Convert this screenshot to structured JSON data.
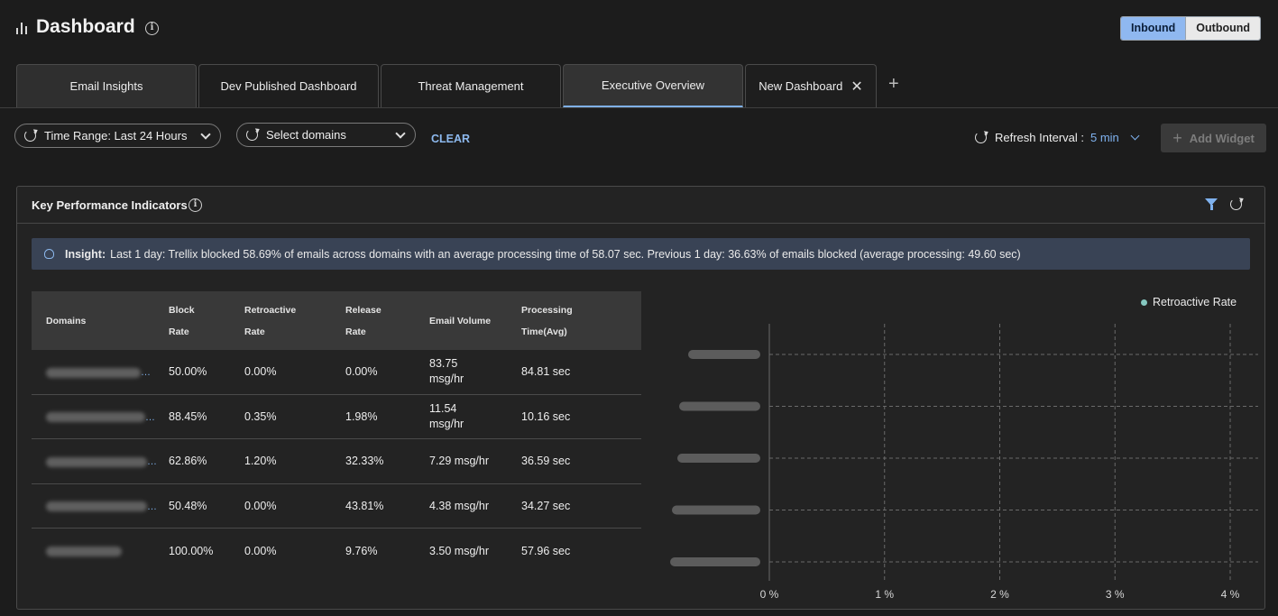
{
  "header": {
    "title": "Dashboard",
    "direction_toggle": {
      "options": [
        "Inbound",
        "Outbound"
      ],
      "selected": "Inbound"
    }
  },
  "tabs": [
    {
      "label": "Email Insights"
    },
    {
      "label": "Dev Published Dashboard"
    },
    {
      "label": "Threat Management"
    },
    {
      "label": "Executive Overview",
      "selected": true
    },
    {
      "label": "New Dashboard",
      "closable": true
    }
  ],
  "filters": {
    "time_range": "Time Range: Last 24 Hours",
    "domains_placeholder": "Select domains",
    "clear": "CLEAR",
    "refresh_label": "Refresh Interval :",
    "refresh_value": "5 min",
    "add_widget": "Add Widget"
  },
  "panel": {
    "title": "Key Performance Indicators",
    "insight_label": "Insight:",
    "insight_text": "Last 1 day: Trellix blocked 58.69% of emails across domains with an average processing time of 58.07 sec. Previous 1 day: 36.63% of emails blocked (average processing: 49.60 sec)"
  },
  "table": {
    "headers": {
      "domains": "Domains",
      "block_1": "Block",
      "block_2": "Rate",
      "retro_1": "Retroactive",
      "retro_2": "Rate",
      "release_1": "Release",
      "release_2": "Rate",
      "volume": "Email Volume",
      "proc_1": "Processing",
      "proc_2": "Time(Avg)"
    },
    "rows": [
      {
        "block": "50.00%",
        "retro": "0.00%",
        "release": "0.00%",
        "volume": "83.75 msg/hr",
        "proc": "84.81 sec"
      },
      {
        "block": "88.45%",
        "retro": "0.35%",
        "release": "1.98%",
        "volume": "11.54 msg/hr",
        "proc": "10.16 sec"
      },
      {
        "block": "62.86%",
        "retro": "1.20%",
        "release": "32.33%",
        "volume": "7.29 msg/hr",
        "proc": "36.59 sec"
      },
      {
        "block": "50.48%",
        "retro": "0.00%",
        "release": "43.81%",
        "volume": "4.38 msg/hr",
        "proc": "34.27 sec"
      },
      {
        "block": "100.00%",
        "retro": "0.00%",
        "release": "9.76%",
        "volume": "3.50 msg/hr",
        "proc": "57.96 sec"
      }
    ]
  },
  "chart_data": {
    "type": "bar",
    "orientation": "horizontal",
    "series": [
      {
        "name": "Retroactive Rate",
        "values": [
          0,
          0,
          0,
          0,
          0
        ]
      }
    ],
    "x_tick_labels": [
      "0 %",
      "1 %",
      "2 %",
      "3 %",
      "4 %"
    ],
    "xlim": [
      0,
      4
    ],
    "grid": true,
    "legend": "top-right",
    "colors": {
      "series": "#86c8c0"
    }
  }
}
